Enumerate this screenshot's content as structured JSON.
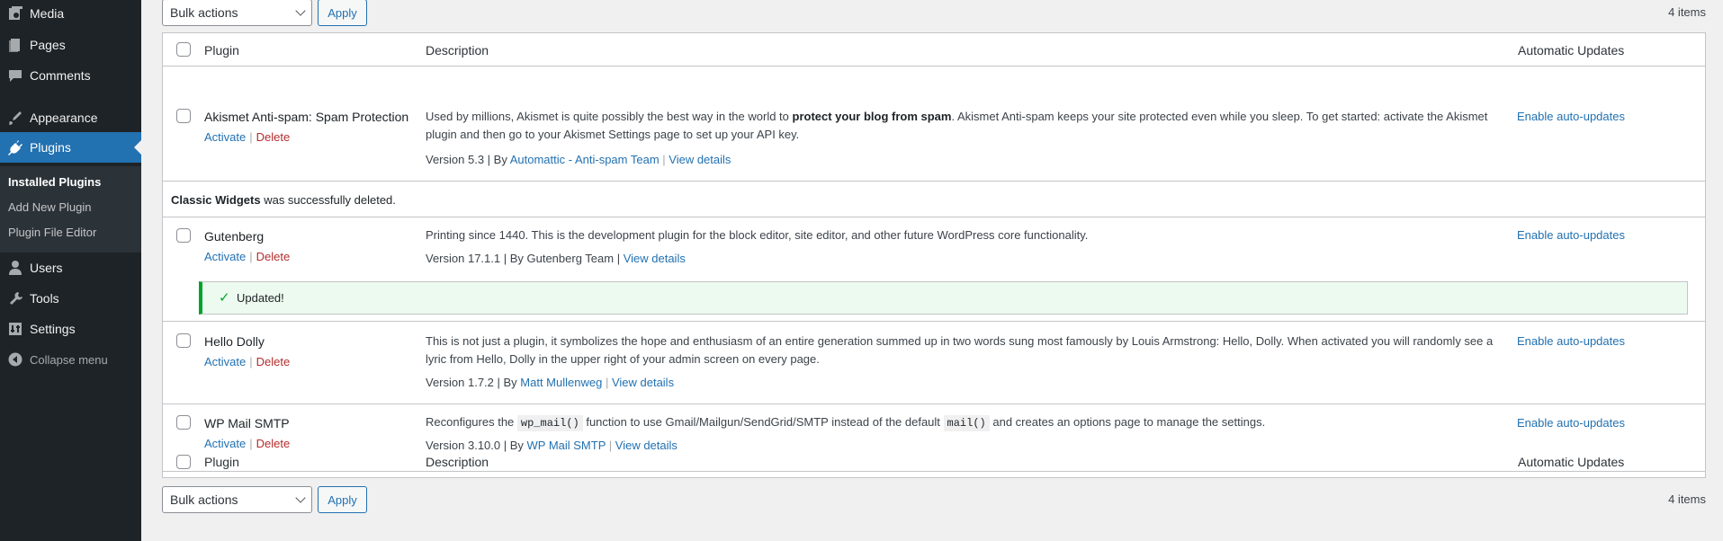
{
  "sidebar": {
    "items": [
      {
        "label": "Media",
        "icon": "media-icon"
      },
      {
        "label": "Pages",
        "icon": "pages-icon"
      },
      {
        "label": "Comments",
        "icon": "comments-icon"
      },
      {
        "label": "Appearance",
        "icon": "appearance-icon"
      },
      {
        "label": "Plugins",
        "icon": "plugins-icon"
      },
      {
        "label": "Users",
        "icon": "users-icon"
      },
      {
        "label": "Tools",
        "icon": "tools-icon"
      },
      {
        "label": "Settings",
        "icon": "settings-icon"
      }
    ],
    "submenu": [
      "Installed Plugins",
      "Add New Plugin",
      "Plugin File Editor"
    ],
    "collapse_label": "Collapse menu"
  },
  "tablenav": {
    "bulk_label": "Bulk actions",
    "apply_label": "Apply",
    "count": "4 items"
  },
  "table": {
    "headers": {
      "plugin": "Plugin",
      "description": "Description",
      "auto_updates": "Automatic Updates"
    },
    "plugins": [
      {
        "name": "Akismet Anti-spam: Spam Protection",
        "activate": "Activate",
        "delete": "Delete",
        "desc_pre": "Used by millions, Akismet is quite possibly the best way in the world to ",
        "desc_bold": "protect your blog from spam",
        "desc_post": ". Akismet Anti-spam keeps your site protected even while you sleep. To get started: activate the Akismet plugin and then go to your Akismet Settings page to set up your API key.",
        "version": "Version 5.3 | By ",
        "author": "Automattic - Anti-spam Team",
        "view_details": "View details",
        "auto": "Enable auto-updates"
      },
      {
        "name": "Gutenberg",
        "activate": "Activate",
        "delete": "Delete",
        "desc": "Printing since 1440. This is the development plugin for the block editor, site editor, and other future WordPress core functionality.",
        "version": "Version 17.1.1 | By Gutenberg Team | ",
        "view_details": "View details",
        "auto": "Enable auto-updates"
      },
      {
        "name": "Hello Dolly",
        "activate": "Activate",
        "delete": "Delete",
        "desc": "This is not just a plugin, it symbolizes the hope and enthusiasm of an entire generation summed up in two words sung most famously by Louis Armstrong: Hello, Dolly. When activated you will randomly see a lyric from Hello, Dolly in the upper right of your admin screen on every page.",
        "version": "Version 1.7.2 | By ",
        "author": "Matt Mullenweg",
        "view_details": "View details",
        "auto": "Enable auto-updates"
      },
      {
        "name": "WP Mail SMTP",
        "activate": "Activate",
        "delete": "Delete",
        "desc_a": "Reconfigures the ",
        "code1": "wp_mail()",
        "desc_b": " function to use Gmail/Mailgun/SendGrid/SMTP instead of the default ",
        "code2": "mail()",
        "desc_c": " and creates an options page to manage the settings.",
        "version": "Version 3.10.0 | By ",
        "author": "WP Mail SMTP",
        "view_details": "View details",
        "auto": "Enable auto-updates"
      }
    ],
    "deleted_notice_bold": "Classic Widgets",
    "deleted_notice_rest": " was successfully deleted.",
    "updated_notice": "Updated!"
  },
  "colors": {
    "accent": "#2271b1",
    "sidebar": "#1d2327",
    "delete": "#b32d2e",
    "success": "#00a32a"
  }
}
